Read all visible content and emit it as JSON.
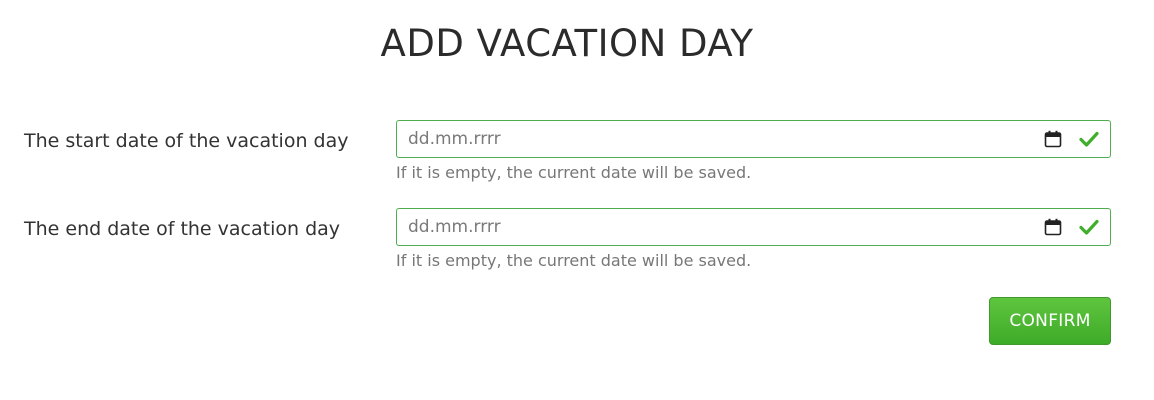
{
  "page": {
    "title": "ADD VACATION DAY"
  },
  "form": {
    "start_date": {
      "label": "The start date of the vacation day",
      "placeholder": "dd.mm.rrrr",
      "help": "If it is empty, the current date will be saved."
    },
    "end_date": {
      "label": "The end date of the vacation day",
      "placeholder": "dd.mm.rrrr",
      "help": "If it is empty, the current date will be saved."
    },
    "confirm_label": "CONFIRM"
  },
  "icons": {
    "calendar": "calendar-icon",
    "valid": "checkmark-icon"
  },
  "colors": {
    "valid_border": "#4cae4c",
    "check": "#3fae2a",
    "button": "#4bb531",
    "button_text": "#ffffff"
  }
}
